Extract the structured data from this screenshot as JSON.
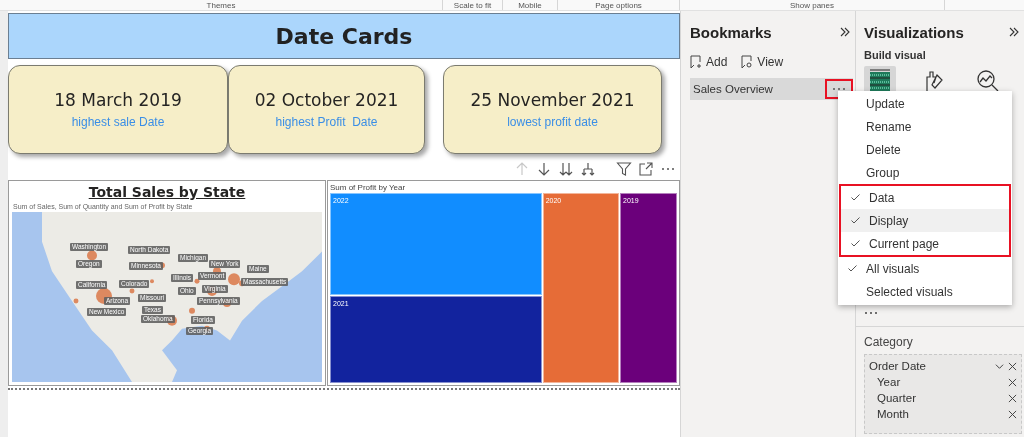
{
  "ribbon": {
    "groups": [
      "Themes",
      "Scale to fit",
      "Mobile",
      "Page options",
      "Show panes"
    ]
  },
  "canvas": {
    "banner": {
      "title": "Date Cards"
    },
    "cards": [
      {
        "value": "18 March 2019",
        "label": "highest sale Date"
      },
      {
        "value": "02 October 2021",
        "label": "highest Profit  Date"
      },
      {
        "value": "25 November 2021",
        "label": "lowest profit date"
      }
    ],
    "visual_header": {
      "drill_up_disabled": true
    },
    "map_visual": {
      "title": "Total Sales by State",
      "subtitle": "Sum of Sales, Sum of Quantity and Sum of Profit by State",
      "state_labels": [
        "Washington",
        "Oregon",
        "California",
        "Arizona",
        "New Mexico",
        "North Dakota",
        "Minnesota",
        "Colorado",
        "Missouri",
        "Texas",
        "Oklahoma",
        "Michigan",
        "New York",
        "Illinois",
        "Vermont",
        "Ohio",
        "Virginia",
        "Pennsylvania",
        "Florida",
        "Georgia",
        "Maine",
        "Massachusetts"
      ]
    },
    "treemap_visual": {
      "title": "Sum of Profit by Year",
      "tiles": [
        {
          "label": "2022",
          "color": "#118dff"
        },
        {
          "label": "2021",
          "color": "#12239e"
        },
        {
          "label": "2020",
          "color": "#e66c37"
        },
        {
          "label": "2019",
          "color": "#6b007b"
        }
      ]
    }
  },
  "bookmarks_pane": {
    "title": "Bookmarks",
    "actions": [
      "Add",
      "View"
    ],
    "items": [
      {
        "label": "Sales Overview",
        "selected": true,
        "more_highlighted": true
      }
    ]
  },
  "visualizations_pane": {
    "title": "Visualizations",
    "section": "Build visual",
    "build_tabs": [
      {
        "selected": true
      },
      {
        "selected": false
      },
      {
        "selected": false
      }
    ],
    "field_well": {
      "label": "Category",
      "field": "Order Date",
      "items": [
        "Year",
        "Quarter",
        "Month"
      ]
    }
  },
  "context_menu": {
    "actions": [
      "Update",
      "Rename",
      "Delete",
      "Group"
    ],
    "options": [
      {
        "label": "Data",
        "checked": true,
        "hovered": false,
        "highlighted": true
      },
      {
        "label": "Display",
        "checked": true,
        "hovered": true,
        "highlighted": true
      },
      {
        "label": "Current page",
        "checked": true,
        "hovered": false,
        "highlighted": true
      },
      {
        "label": "All visuals",
        "checked": true,
        "hovered": false,
        "highlighted": false
      },
      {
        "label": "Selected visuals",
        "checked": false,
        "hovered": false,
        "highlighted": false
      }
    ]
  }
}
